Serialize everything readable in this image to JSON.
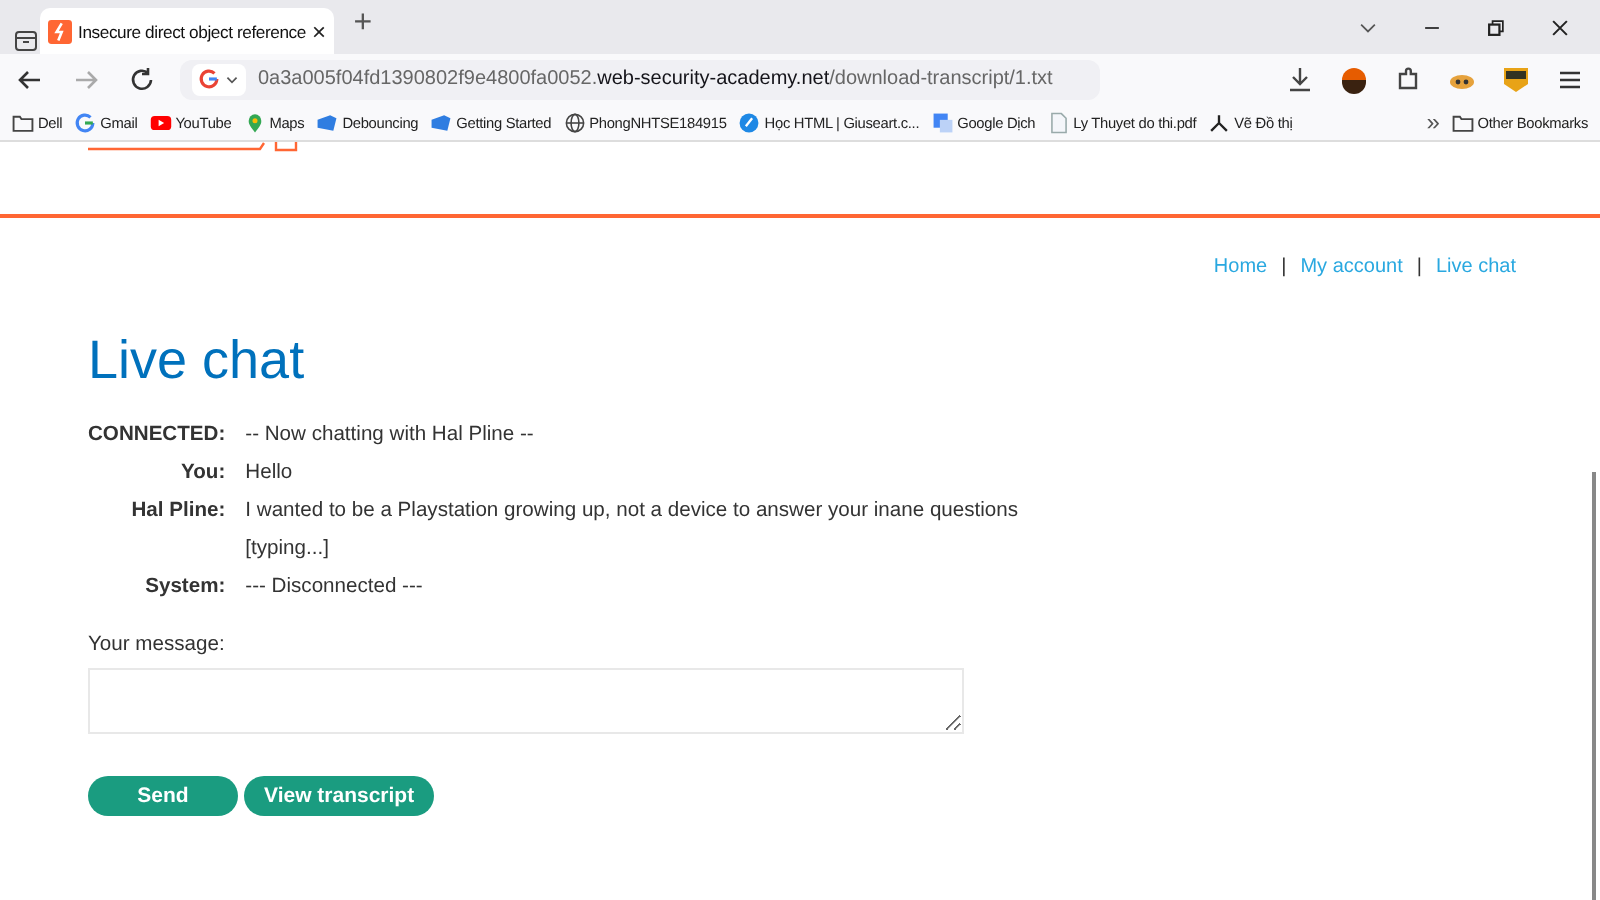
{
  "browser": {
    "tab": {
      "title": "Insecure direct object reference",
      "close": "×"
    },
    "new_tab": "+",
    "address": {
      "prefix": "0a3a005f04fd1390802f9e4800fa0052.",
      "host": "web-security-academy.net",
      "path": "/download-transcript/1.txt"
    },
    "bookmarks": [
      {
        "label": "Dell",
        "kind": "folder"
      },
      {
        "label": "Gmail",
        "kind": "g"
      },
      {
        "label": "YouTube",
        "kind": "youtube"
      },
      {
        "label": "Maps",
        "kind": "pin"
      },
      {
        "label": "Debouncing",
        "kind": "blue"
      },
      {
        "label": "Getting Started",
        "kind": "blue"
      },
      {
        "label": "PhongNHTSE184915",
        "kind": "globe"
      },
      {
        "label": "Học HTML | Giuseart.c...",
        "kind": "circle"
      },
      {
        "label": "Google Dịch",
        "kind": "translate"
      },
      {
        "label": "Ly Thuyet do thi.pdf",
        "kind": "doc"
      },
      {
        "label": "Vẽ Đồ thị",
        "kind": "graph"
      }
    ],
    "more": "»",
    "other_bookmarks": "Other Bookmarks"
  },
  "nav": [
    "Home",
    "My account",
    "Live chat"
  ],
  "nav_separators": [
    "|",
    "|"
  ],
  "title": "Live chat",
  "messages": [
    {
      "author": "CONNECTED:",
      "text": "-- Now chatting with Hal Pline --"
    },
    {
      "author": "You:",
      "text": "Hello"
    },
    {
      "author": "Hal Pline:",
      "text": "I wanted to be a Playstation growing up, not a device to answer your inane questions"
    },
    {
      "text": "[typing...]"
    },
    {
      "author": "System:",
      "text": "--- Disconnected ---"
    }
  ],
  "message_label": "Your message:",
  "buttons": [
    "Send",
    "View transcript"
  ]
}
